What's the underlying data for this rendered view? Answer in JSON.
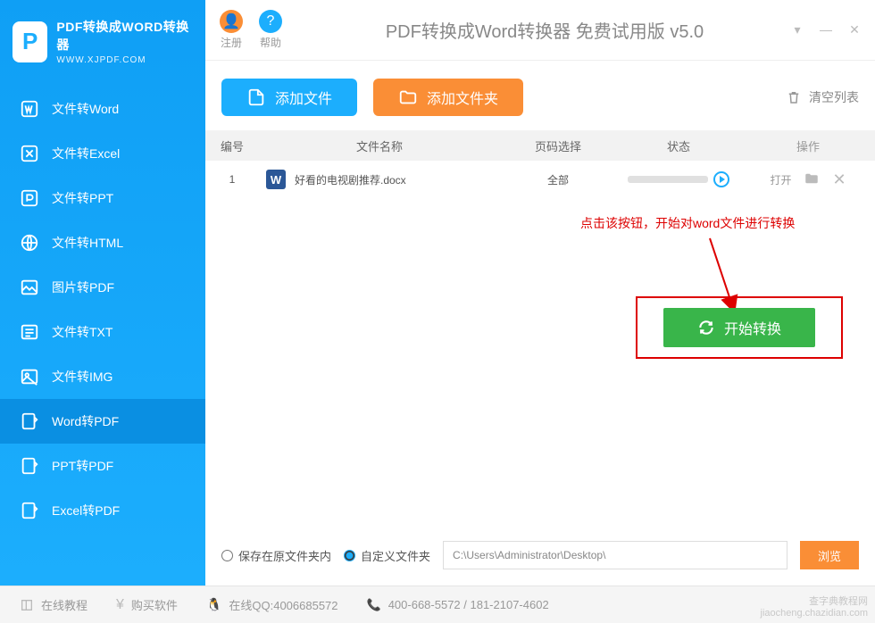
{
  "logo": {
    "title": "PDF转换成WORD转换器",
    "subtitle": "WWW.XJPDF.COM",
    "mark": "P"
  },
  "nav": [
    {
      "label": "文件转Word"
    },
    {
      "label": "文件转Excel"
    },
    {
      "label": "文件转PPT"
    },
    {
      "label": "文件转HTML"
    },
    {
      "label": "图片转PDF"
    },
    {
      "label": "文件转TXT"
    },
    {
      "label": "文件转IMG"
    },
    {
      "label": "Word转PDF"
    },
    {
      "label": "PPT转PDF"
    },
    {
      "label": "Excel转PDF"
    }
  ],
  "titlebar": {
    "register": "注册",
    "help": "帮助",
    "title": "PDF转换成Word转换器 免费试用版 v5.0"
  },
  "toolbar": {
    "add_file": "添加文件",
    "add_folder": "添加文件夹",
    "clear": "清空列表"
  },
  "columns": {
    "idx": "编号",
    "name": "文件名称",
    "page": "页码选择",
    "status": "状态",
    "action": "操作"
  },
  "rows": [
    {
      "idx": "1",
      "name": "好看的电视剧推荐.docx",
      "page": "全部",
      "open": "打开"
    }
  ],
  "annotation": "点击该按钮，开始对word文件进行转换",
  "start_button": "开始转换",
  "save": {
    "opt1": "保存在原文件夹内",
    "opt2": "自定义文件夹",
    "path": "C:\\Users\\Administrator\\Desktop\\",
    "browse": "浏览"
  },
  "statusbar": {
    "tutorial": "在线教程",
    "buy": "购买软件",
    "qq_label": "在线QQ:4006685572",
    "phone": "400-668-5572 / 181-2107-4602"
  },
  "watermark": {
    "l1": "查字典教程网",
    "l2": "jiaocheng.chazidian.com"
  }
}
